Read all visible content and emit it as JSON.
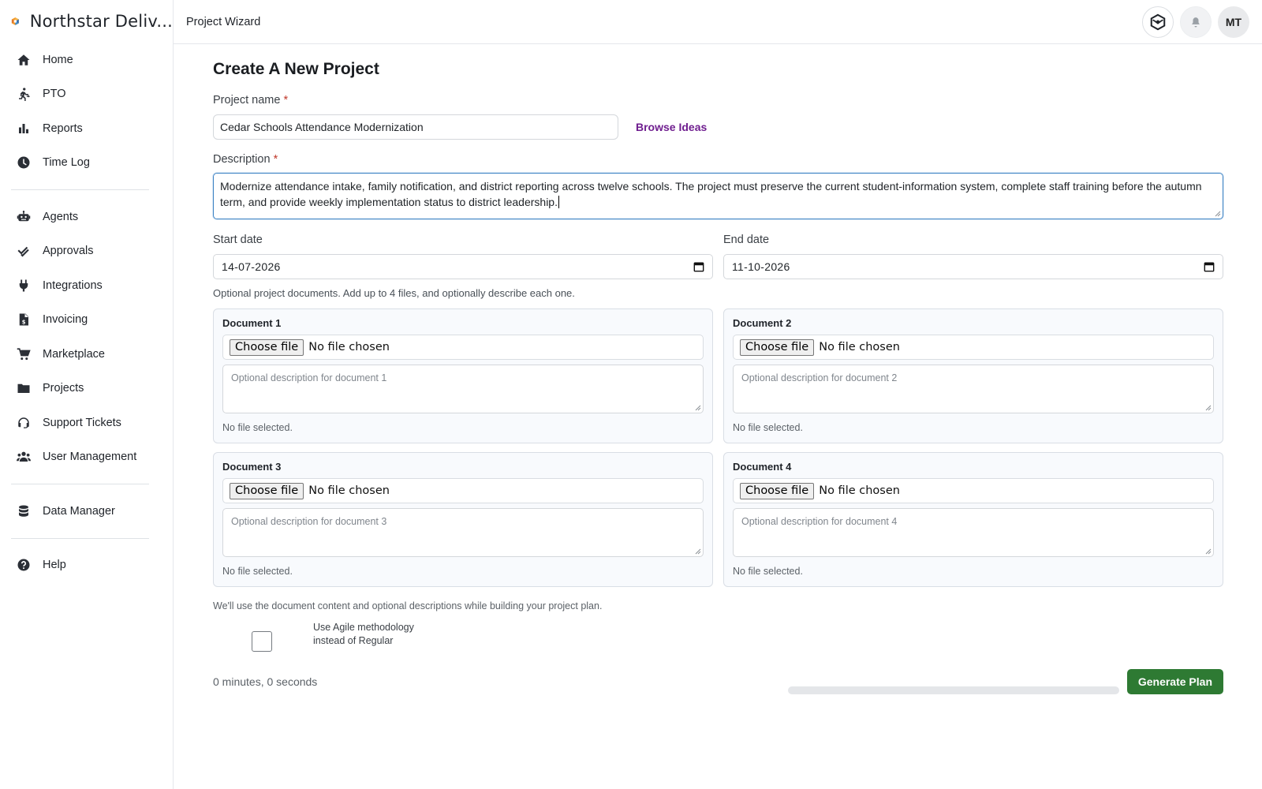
{
  "app": {
    "brand_name": "Northstar Deliv...",
    "page_title": "Project Wizard",
    "avatar_initials": "MT"
  },
  "sidebar": {
    "groups": [
      [
        {
          "label": "Home",
          "icon": "home-icon"
        },
        {
          "label": "PTO",
          "icon": "running-person-icon"
        },
        {
          "label": "Reports",
          "icon": "bar-chart-icon"
        },
        {
          "label": "Time Log",
          "icon": "clock-icon"
        }
      ],
      [
        {
          "label": "Agents",
          "icon": "robot-icon"
        },
        {
          "label": "Approvals",
          "icon": "double-check-icon"
        },
        {
          "label": "Integrations",
          "icon": "plug-icon"
        },
        {
          "label": "Invoicing",
          "icon": "invoice-icon"
        },
        {
          "label": "Marketplace",
          "icon": "cart-icon"
        },
        {
          "label": "Projects",
          "icon": "folder-icon"
        },
        {
          "label": "Support Tickets",
          "icon": "headset-icon"
        },
        {
          "label": "User Management",
          "icon": "users-icon"
        }
      ],
      [
        {
          "label": "Data Manager",
          "icon": "database-icon"
        }
      ],
      [
        {
          "label": "Help",
          "icon": "help-icon"
        }
      ]
    ]
  },
  "form": {
    "heading": "Create A New Project",
    "project_name_label": "Project name",
    "required_mark": "*",
    "project_name_value": "Cedar Schools Attendance Modernization",
    "browse_ideas": "Browse Ideas",
    "description_label": "Description",
    "description_value": "Modernize attendance intake, family notification, and district reporting across twelve schools. The project must preserve the current student-information system, complete staff training before the autumn term, and provide weekly implementation status to district leadership.",
    "start_date_label": "Start date",
    "start_date_value": "14-07-2026",
    "end_date_label": "End date",
    "end_date_value": "11-10-2026",
    "documents_helper": "Optional project documents. Add up to 4 files, and optionally describe each one.",
    "documents": [
      {
        "title": "Document 1",
        "choose_label": "Choose file",
        "file_status": "No file chosen",
        "placeholder": "Optional description for document 1",
        "note": "No file selected."
      },
      {
        "title": "Document 2",
        "choose_label": "Choose file",
        "file_status": "No file chosen",
        "placeholder": "Optional description for document 2",
        "note": "No file selected."
      },
      {
        "title": "Document 3",
        "choose_label": "Choose file",
        "file_status": "No file chosen",
        "placeholder": "Optional description for document 3",
        "note": "No file selected."
      },
      {
        "title": "Document 4",
        "choose_label": "Choose file",
        "file_status": "No file chosen",
        "placeholder": "Optional description for document 4",
        "note": "No file selected."
      }
    ],
    "documents_footnote": "We'll use the document content and optional descriptions while building your project plan.",
    "agile_label": "Use Agile methodology instead of Regular",
    "agile_checked": false,
    "timer": "0 minutes, 0 seconds",
    "progress_fraction": 0,
    "generate_button": "Generate Plan"
  },
  "colors": {
    "accent_purple": "#6f1e8f",
    "primary_green": "#2e7a33",
    "focus_blue": "#3b82c4"
  }
}
